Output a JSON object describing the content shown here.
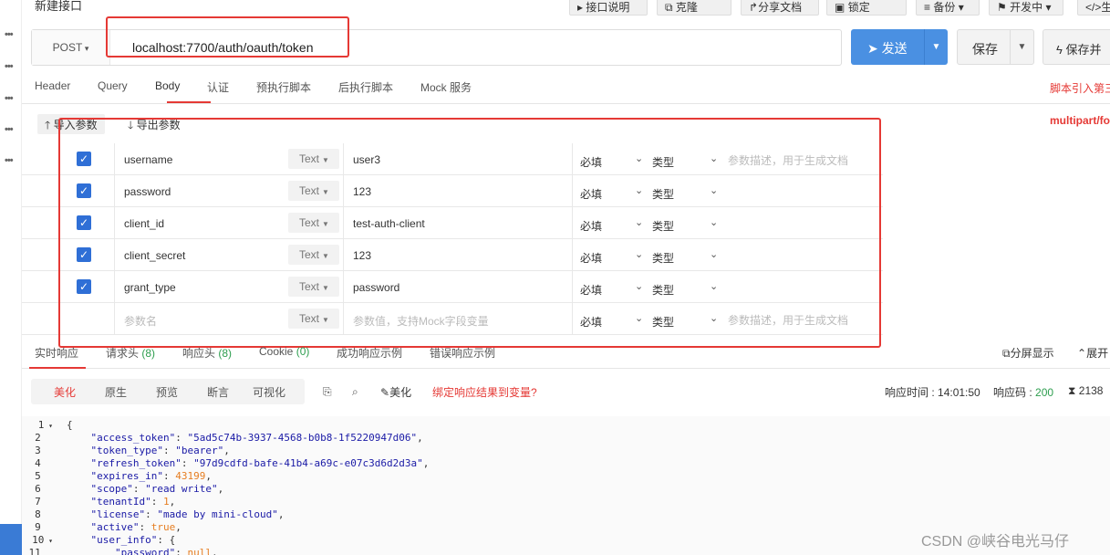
{
  "toolbar": {
    "title": "新建接口",
    "buttons": [
      "接口说明",
      "克隆",
      "分享文档",
      "锁定",
      "备份",
      "开发中",
      "生"
    ]
  },
  "request": {
    "method": "POST",
    "url": "localhost:7700/auth/oauth/token",
    "send_label": "发送",
    "save_label": "保存",
    "save_run_label": "保存并"
  },
  "tabs": [
    "Header",
    "Query",
    "Body",
    "认证",
    "预执行脚本",
    "后执行脚本",
    "Mock 服务"
  ],
  "active_tab": "Body",
  "script_note": "脚本引入第三",
  "body": {
    "import_label": "导入参数",
    "export_label": "导出参数",
    "content_type": "multipart/fo",
    "params": [
      {
        "checked": true,
        "name": "username",
        "type": "Text",
        "value": "user3",
        "required": "必填",
        "kind": "类型",
        "desc": "参数描述，用于生成文档"
      },
      {
        "checked": true,
        "name": "password",
        "type": "Text",
        "value": "123",
        "required": "必填",
        "kind": "类型",
        "desc": ""
      },
      {
        "checked": true,
        "name": "client_id",
        "type": "Text",
        "value": "test-auth-client",
        "required": "必填",
        "kind": "类型",
        "desc": ""
      },
      {
        "checked": true,
        "name": "client_secret",
        "type": "Text",
        "value": "123",
        "required": "必填",
        "kind": "类型",
        "desc": ""
      },
      {
        "checked": true,
        "name": "grant_type",
        "type": "Text",
        "value": "password",
        "required": "必填",
        "kind": "类型",
        "desc": ""
      }
    ],
    "new_row": {
      "name_placeholder": "参数名",
      "type": "Text",
      "value_placeholder": "参数值，支持Mock字段变量",
      "required": "必填",
      "kind": "类型",
      "desc_placeholder": "参数描述，用于生成文档"
    }
  },
  "response": {
    "tabs": [
      {
        "label": "实时响应",
        "count": ""
      },
      {
        "label": "请求头",
        "count": "(8)"
      },
      {
        "label": "响应头",
        "count": "(8)"
      },
      {
        "label": "Cookie",
        "count": "(0)"
      },
      {
        "label": "成功响应示例",
        "count": ""
      },
      {
        "label": "错误响应示例",
        "count": ""
      }
    ],
    "split_label": "分屏显示",
    "expand_label": "展开",
    "view_tabs": [
      "美化",
      "原生",
      "预览",
      "断言",
      "可视化"
    ],
    "active_view": "美化",
    "beautify_label": "美化",
    "bind_var_label": "绑定响应结果到变量?",
    "time_label": "响应时间 : ",
    "time_value": "14:01:50",
    "code_label": "响应码 : ",
    "code_value": "200",
    "size_value": "2138"
  },
  "code_lines": [
    {
      "n": "1",
      "t": "{",
      "fold": true
    },
    {
      "n": "2",
      "t": "    \"access_token\": \"5ad5c74b-3937-4568-b0b8-1f5220947d06\","
    },
    {
      "n": "3",
      "t": "    \"token_type\": \"bearer\","
    },
    {
      "n": "4",
      "t": "    \"refresh_token\": \"97d9cdfd-bafe-41b4-a69c-e07c3d6d2d3a\","
    },
    {
      "n": "5",
      "t": "    \"expires_in\": 43199,"
    },
    {
      "n": "6",
      "t": "    \"scope\": \"read write\","
    },
    {
      "n": "7",
      "t": "    \"tenantId\": 1,"
    },
    {
      "n": "8",
      "t": "    \"license\": \"made by mini-cloud\","
    },
    {
      "n": "9",
      "t": "    \"active\": true,"
    },
    {
      "n": "10",
      "t": "    \"user_info\": {",
      "fold": true
    },
    {
      "n": "11",
      "t": "        \"password\": null,"
    }
  ],
  "watermark": "CSDN @峡谷电光马仔"
}
